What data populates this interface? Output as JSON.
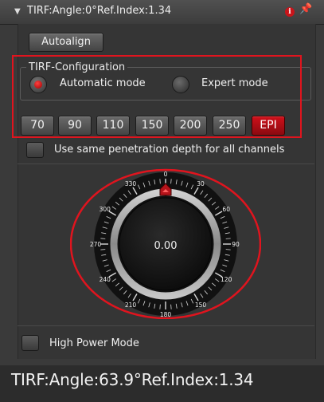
{
  "header": {
    "title": "TIRF:Angle:0°Ref.Index:1.34",
    "info_glyph": "i",
    "pin_glyph": "📌",
    "collapse_glyph": "▼"
  },
  "autoalign_label": "Autoalign",
  "config": {
    "legend": "TIRF-Configuration",
    "modes": [
      {
        "label": "Automatic mode",
        "selected": true
      },
      {
        "label": "Expert mode",
        "selected": false
      }
    ]
  },
  "depth_buttons": [
    {
      "label": "70",
      "active": false
    },
    {
      "label": "90",
      "active": false
    },
    {
      "label": "110",
      "active": false
    },
    {
      "label": "150",
      "active": false
    },
    {
      "label": "200",
      "active": false
    },
    {
      "label": "250",
      "active": false
    },
    {
      "label": "EPI",
      "active": true
    }
  ],
  "same_depth_label": "Use same penetration depth for all channels",
  "dial": {
    "value_text": "0.00",
    "indicator_angle_deg": 0,
    "tick_labels": [
      "0",
      "30",
      "60",
      "90",
      "120",
      "150",
      "180",
      "210",
      "240",
      "270",
      "300",
      "330"
    ]
  },
  "high_power_label": "High Power Mode",
  "footer_readout": "TIRF:Angle:63.9°Ref.Index:1.34",
  "colors": {
    "accent_red": "#e0141e",
    "panel_bg": "#3a3a3a"
  }
}
